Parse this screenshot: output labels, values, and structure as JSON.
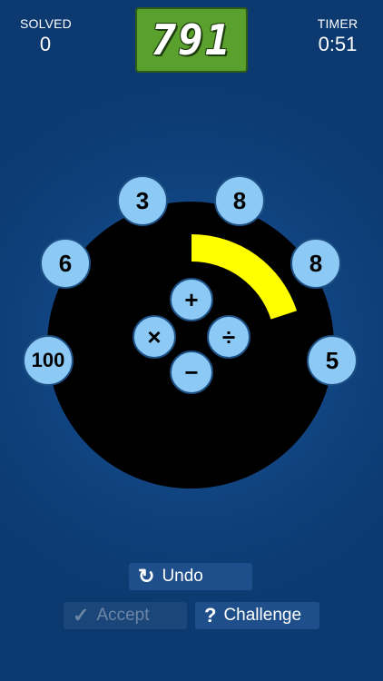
{
  "stats": {
    "solved_label": "SOLVED",
    "solved_value": "0",
    "timer_label": "TIMER",
    "timer_value": "0:51"
  },
  "target": {
    "value": "791"
  },
  "numbers": [
    "3",
    "8",
    "6",
    "8",
    "100",
    "5"
  ],
  "operators": {
    "add": "+",
    "multiply": "×",
    "divide": "÷",
    "subtract": "−"
  },
  "timer_arc": {
    "fraction_elapsed": 0.2
  },
  "buttons": {
    "undo": {
      "label": "Undo",
      "icon": "undo-icon",
      "glyph": "↻"
    },
    "accept": {
      "label": "Accept",
      "icon": "check-icon",
      "glyph": "✓",
      "enabled": false
    },
    "challenge": {
      "label": "Challenge",
      "icon": "question-icon",
      "glyph": "?"
    }
  },
  "colors": {
    "background": "#0c3a70",
    "target_bg": "#5aa02c",
    "tile": "#8cc9f4",
    "arc": "#ffff00",
    "board": "#000000"
  }
}
